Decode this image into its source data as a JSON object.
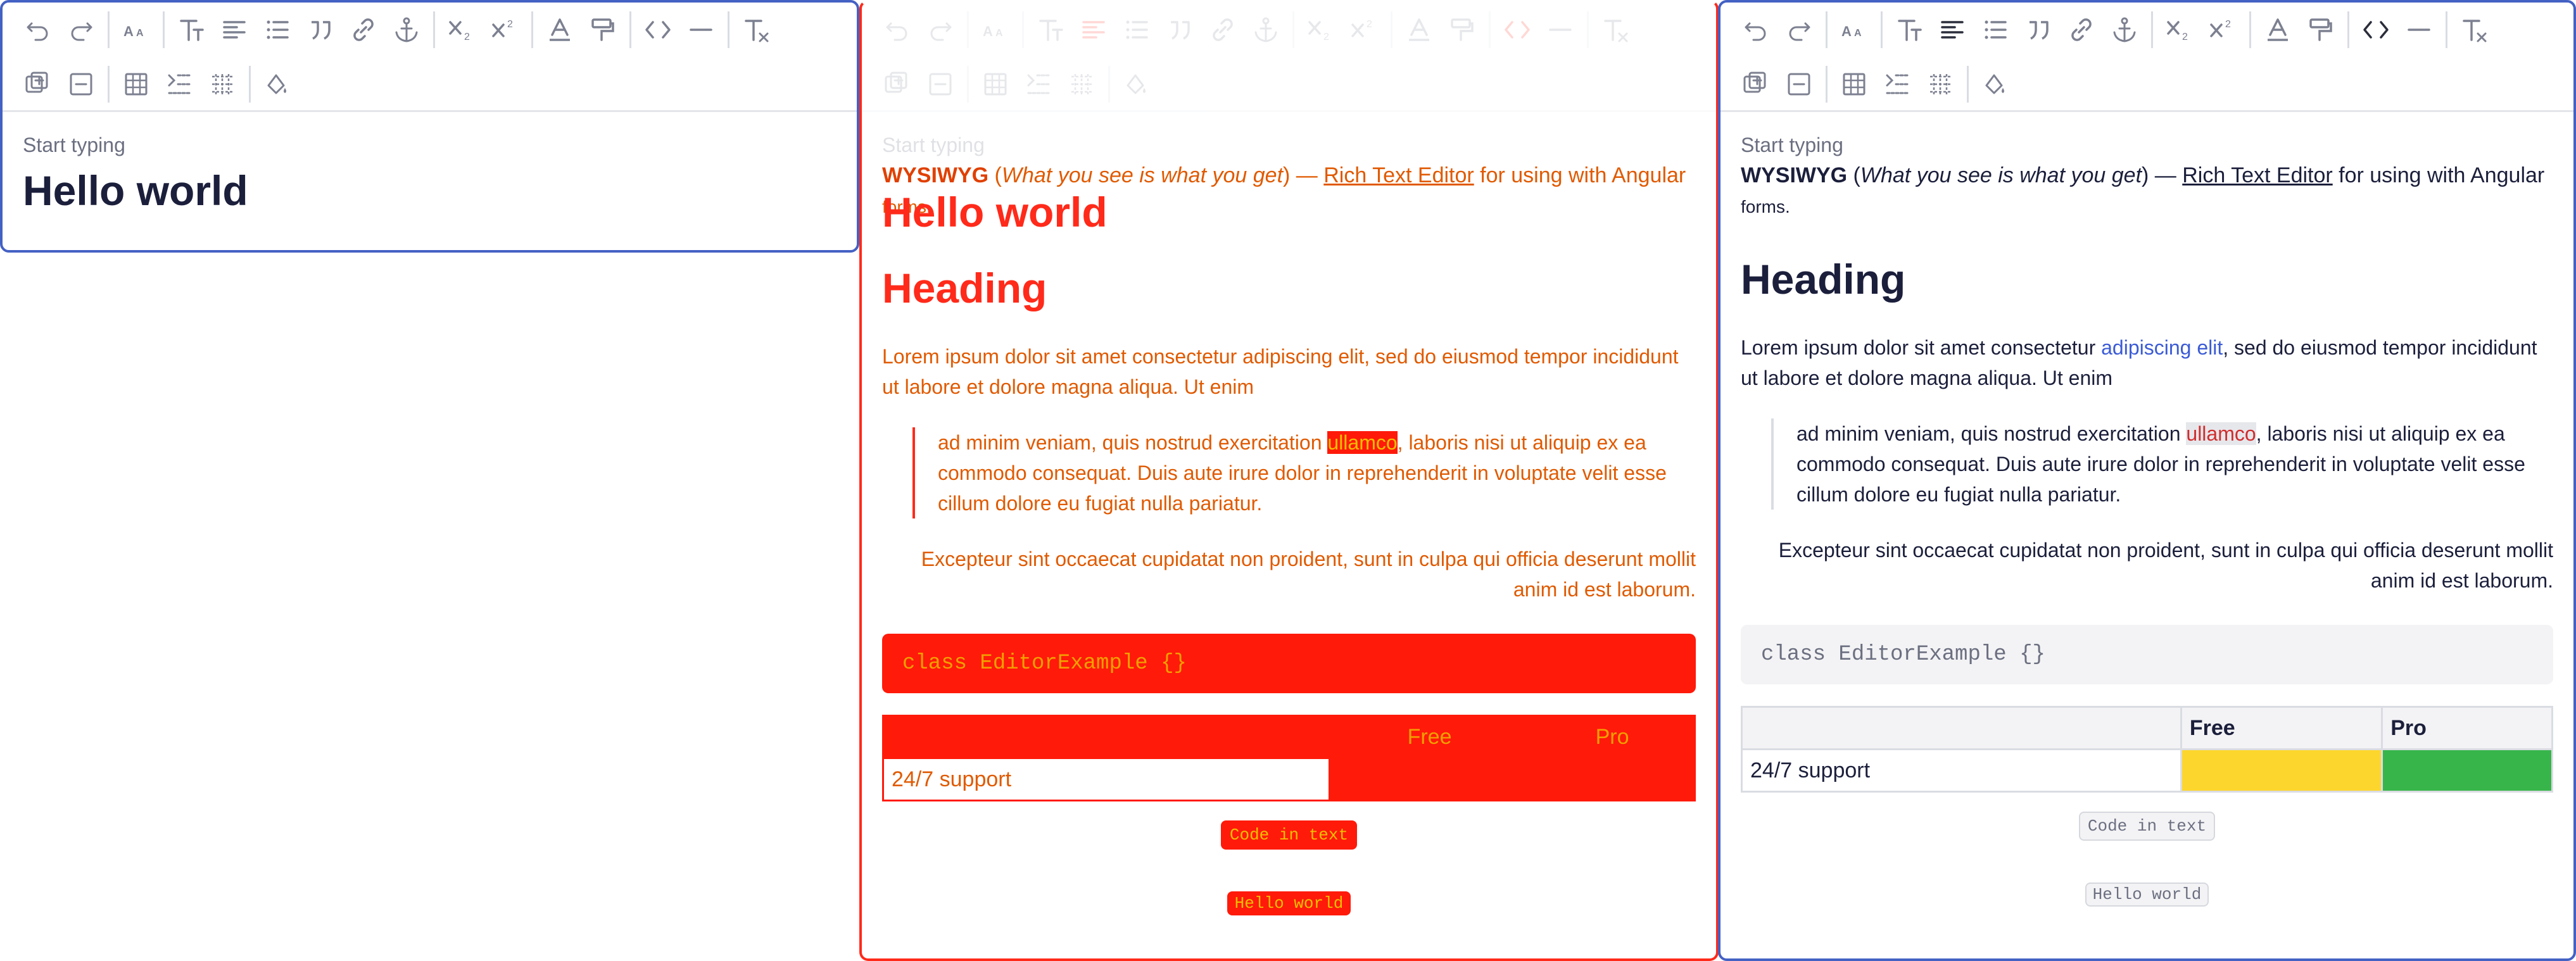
{
  "colors": {
    "border_blue": "#4461c4",
    "border_red": "#ff2a1a",
    "heading": "#1b1f3b",
    "link": "#3b5bd6",
    "highlight_text": "#d12d2d",
    "cell_yellow": "#fcd62d",
    "cell_green": "#38b54a"
  },
  "toolbar": {
    "row1": [
      "undo-icon",
      "redo-icon",
      "sep",
      "font-size-icon",
      "sep",
      "text-style-icon",
      "align-left-icon",
      "bullet-list-icon",
      "blockquote-icon",
      "link-icon",
      "anchor-icon",
      "sep",
      "subscript-icon",
      "superscript-icon",
      "sep",
      "text-color-icon",
      "format-painter-icon",
      "sep",
      "code-icon",
      "horizontal-rule-icon",
      "sep",
      "clear-format-icon"
    ],
    "row2": [
      "add-row-icon",
      "remove-row-icon",
      "sep",
      "insert-table-icon",
      "indent-icon",
      "table-grid-icon",
      "sep",
      "fill-color-icon"
    ]
  },
  "editor": {
    "placeholder": "Start typing",
    "title": "Hello world",
    "intro": {
      "bold": "WYSIWYG",
      "paren_open": " (",
      "italic": "What you see is what you get",
      "paren_close": ") — ",
      "link": "Rich Text Editor",
      "rest": " for using with Angular",
      "small": "forms."
    },
    "heading": "Heading",
    "para": {
      "before": "Lorem ipsum dolor sit amet consectetur ",
      "link": "adipiscing elit",
      "after": ", sed do eiusmod tempor incididunt ut labore et dolore magna aliqua. Ut enim"
    },
    "quote": {
      "before": "ad minim veniam, quis nostrud exercitation ",
      "highlight": "ullamco",
      "after": ", laboris nisi ut aliquip ex ea commodo consequat. Duis aute irure dolor in reprehenderit in voluptate velit esse cillum dolore eu fugiat nulla pariatur."
    },
    "right_para": "Excepteur sint occaecat cupidatat non proident, sunt in culpa qui officia deserunt mollit anim id est laborum.",
    "code_block": "class EditorExample {}",
    "table": {
      "headers": [
        "",
        "Free",
        "Pro"
      ],
      "row_label": "24/7 support"
    },
    "inline_code": "Code in text",
    "inline_code2": "Hello world"
  }
}
